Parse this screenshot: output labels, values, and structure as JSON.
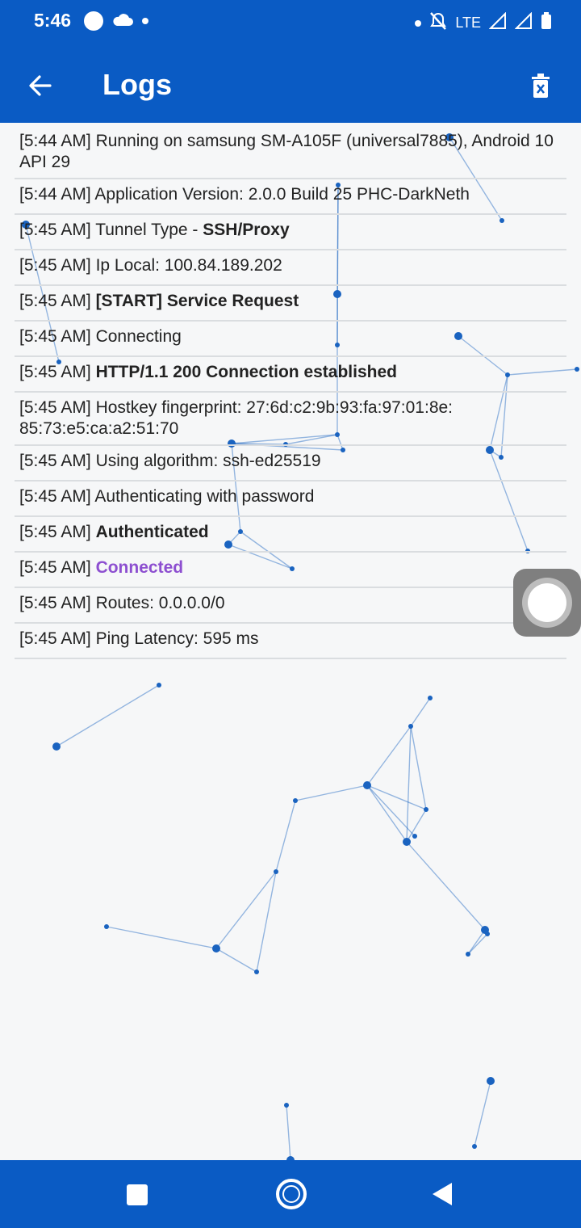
{
  "status_bar": {
    "time": "5:46",
    "network": "LTE"
  },
  "app_bar": {
    "title": "Logs",
    "back_icon": "arrow-left-icon",
    "delete_icon": "trash-icon"
  },
  "logs": [
    {
      "time": "[5:44 AM]",
      "text": "Running on samsung SM-A105F (universal7885), Android 10 API 29",
      "style": "normal"
    },
    {
      "time": "[5:44 AM]",
      "text": "Application Version: 2.0.0 Build 25 PHC-DarkNeth",
      "style": "normal"
    },
    {
      "time": "[5:45 AM]",
      "prefix": "Tunnel Type - ",
      "text": "SSH/Proxy",
      "style": "bold"
    },
    {
      "time": "[5:45 AM]",
      "text": "Ip Local: 100.84.189.202",
      "style": "normal"
    },
    {
      "time": "[5:45 AM]",
      "text": "[START] Service Request",
      "style": "bold"
    },
    {
      "time": "[5:45 AM]",
      "text": "Connecting",
      "style": "normal"
    },
    {
      "time": "[5:45 AM]",
      "text": "HTTP/1.1 200 Connection established",
      "style": "bold"
    },
    {
      "time": "[5:45 AM]",
      "text": "Hostkey fingerprint: 27:6d:c2:9b:93:fa:97:01:8e: 85:73:e5:ca:a2:51:70",
      "style": "normal"
    },
    {
      "time": "[5:45 AM]",
      "text": "Using algorithm: ssh-ed25519",
      "style": "normal"
    },
    {
      "time": "[5:45 AM]",
      "text": "Authenticating with password",
      "style": "normal"
    },
    {
      "time": "[5:45 AM]",
      "text": "Authenticated",
      "style": "bold"
    },
    {
      "time": "[5:45 AM]",
      "text": "Connected",
      "style": "purple"
    },
    {
      "time": "[5:45 AM]",
      "text": "Routes: 0.0.0.0/0",
      "style": "normal"
    },
    {
      "time": "[5:45 AM]",
      "text": "Ping Latency: 595 ms",
      "style": "normal"
    }
  ],
  "colors": {
    "primary": "#0a5bc4",
    "connected": "#8d4fd0",
    "particle": "#1a63c0"
  }
}
